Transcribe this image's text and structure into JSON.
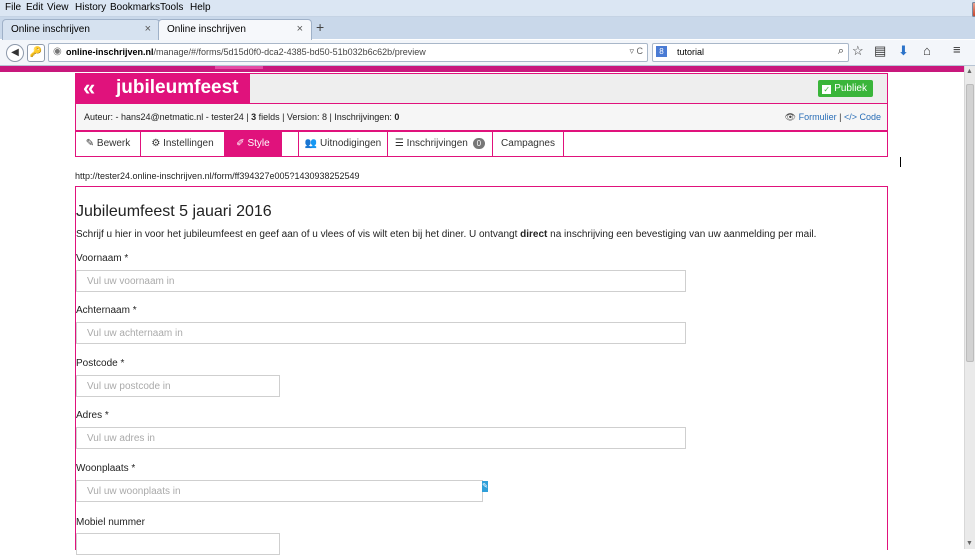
{
  "browser": {
    "menu": [
      "File",
      "Edit",
      "View",
      "History",
      "Bookmarks",
      "Tools",
      "Help"
    ],
    "tabs": [
      {
        "label": "Online inschrijven"
      },
      {
        "label": "Online inschrijven"
      }
    ],
    "new_tab": "+",
    "url_domain": "online-inschrijven.nl",
    "url_path": "/manage/#/forms/5d15d0f0-dca2-4385-bd50-51b032b6c62b/preview",
    "search_query": "tutorial"
  },
  "header": {
    "brand_chevron": "«",
    "brand_name": "jubileumfeest",
    "publiek_label": "Publiek"
  },
  "meta": {
    "prefix": "Auteur: - hans24@netmatic.nl - tester24 | ",
    "fields_count": "3",
    "fields_label": " fields | Version: 8 | Inschrijvingen: ",
    "inschrijvingen": "0",
    "formulier_link": "Formulier",
    "separator": " | ",
    "code_link": "Code"
  },
  "tabs": {
    "bewerk": "Bewerk",
    "instellingen": "Instellingen",
    "style": "Style",
    "uitnodigingen": "Uitnodigingen",
    "inschrijvingen": "Inschrijvingen",
    "inschrijvingen_badge": "0",
    "campagnes": "Campagnes"
  },
  "form_url": "http://tester24.online-inschrijven.nl/form/ff394327e005?1430938252549",
  "form": {
    "title": "Jubileumfeest 5 jauari 2016",
    "description_before": "Schrijf u hier in voor het jubileumfeest en geef aan of u vlees of vis wilt eten bij het diner. U ontvangt ",
    "description_bold": "direct",
    "description_after": " na inschrijving een bevestiging van uw aanmelding per mail.",
    "fields": [
      {
        "label": "Voornaam *",
        "placeholder": "Vul uw voornaam in"
      },
      {
        "label": "Achternaam *",
        "placeholder": "Vul uw achternaam in"
      },
      {
        "label": "Postcode *",
        "placeholder": "Vul uw postcode in"
      },
      {
        "label": "Adres *",
        "placeholder": "Vul uw adres in"
      },
      {
        "label": "Woonplaats *",
        "placeholder": "Vul uw woonplaats in"
      },
      {
        "label": "Mobiel nummer",
        "placeholder": ""
      }
    ]
  },
  "colors": {
    "accent": "#e0127c",
    "publiek": "#3ab53a",
    "link": "#2a6eb7"
  }
}
